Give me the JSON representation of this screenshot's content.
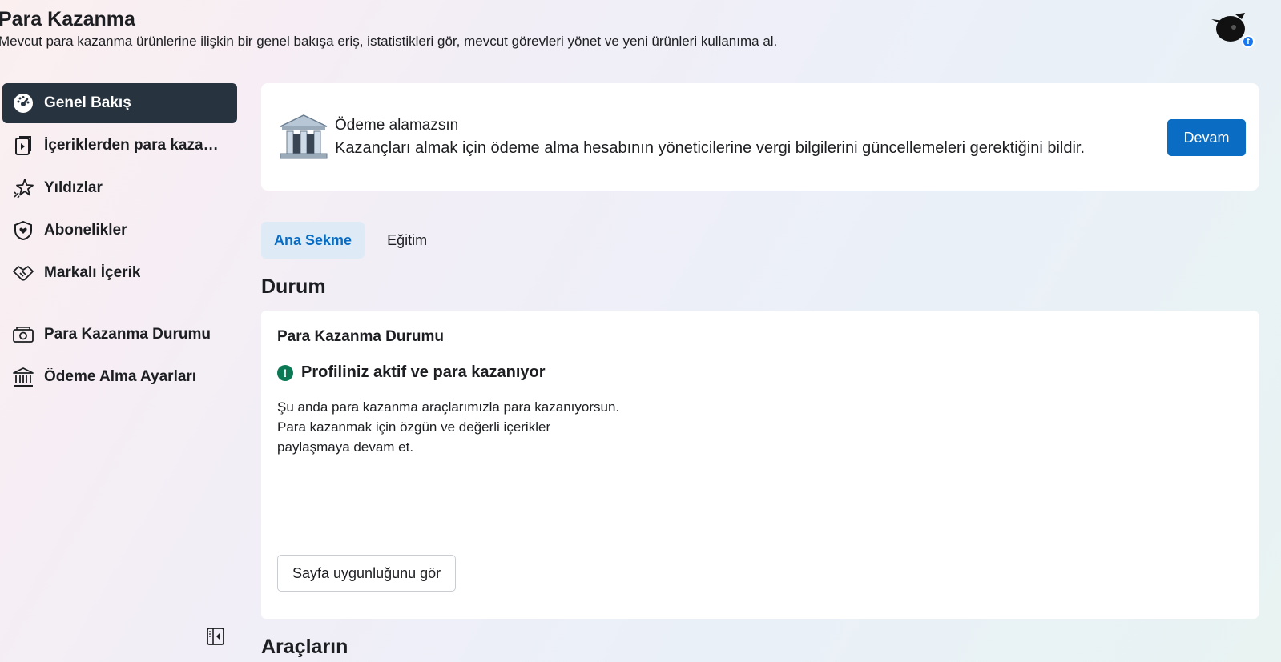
{
  "header": {
    "title": "Para Kazanma",
    "subtitle": "Mevcut para kazanma ürünlerine ilişkin bir genel bakışa eriş, istatistikleri gör, mevcut görevleri yönet ve yeni ürünleri kullanıma al."
  },
  "sidebar": {
    "items": [
      {
        "label": "Genel Bakış",
        "icon": "dashboard-icon"
      },
      {
        "label": "İçeriklerden para kazan...",
        "icon": "video-content-icon"
      },
      {
        "label": "Yıldızlar",
        "icon": "stars-icon"
      },
      {
        "label": "Abonelikler",
        "icon": "subscription-icon"
      },
      {
        "label": "Markalı İçerik",
        "icon": "handshake-icon"
      }
    ],
    "items2": [
      {
        "label": "Para Kazanma Durumu",
        "icon": "money-camera-icon"
      },
      {
        "label": "Ödeme Alma Ayarları",
        "icon": "bank-icon"
      }
    ]
  },
  "alert": {
    "title": "Ödeme alamazsın",
    "body": "Kazançları almak için ödeme alma hesabının yöneticilerine vergi bilgilerini güncellemeleri gerektiğini bildir.",
    "button": "Devam"
  },
  "tabs": [
    {
      "label": "Ana Sekme",
      "active": true
    },
    {
      "label": "Eğitim",
      "active": false
    }
  ],
  "status_section": {
    "title": "Durum",
    "card_title": "Para Kazanma Durumu",
    "status_text": "Profiliniz aktif ve para kazanıyor",
    "description_lines": [
      "Şu anda para kazanma araçlarımızla para kazanıyorsun.",
      "Para kazanmak için özgün ve değerli içerikler",
      "paylaşmaya devam et."
    ],
    "button": "Sayfa uygunluğunu gör"
  },
  "tools_section": {
    "title": "Araçların"
  },
  "colors": {
    "active_nav": "#27343f",
    "primary": "#0a6cc2",
    "success": "#0b7a54"
  }
}
